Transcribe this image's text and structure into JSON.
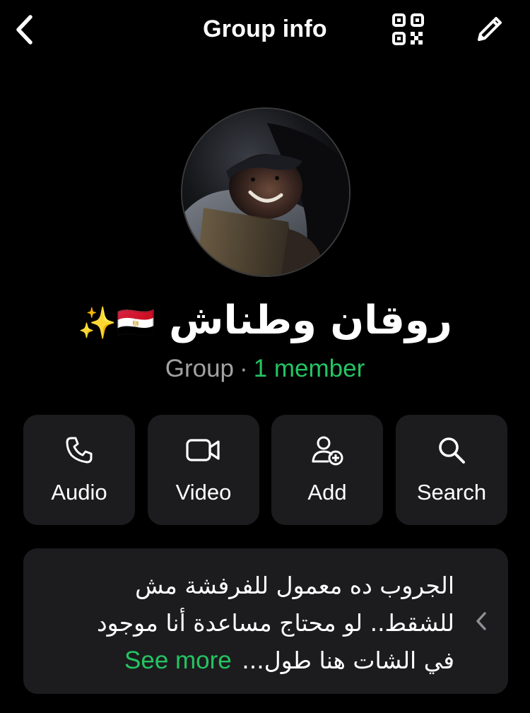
{
  "header": {
    "title": "Group info",
    "back_icon": "chevron-left-icon",
    "qr_icon": "qr-code-icon",
    "edit_icon": "pencil-icon"
  },
  "group": {
    "name": "روقان وطناش",
    "name_emojis": "🇪🇬✨",
    "type": "Group",
    "separator": "·",
    "members": "1 member"
  },
  "actions": [
    {
      "label": "Audio",
      "icon": "phone-icon"
    },
    {
      "label": "Video",
      "icon": "video-camera-icon"
    },
    {
      "label": "Add",
      "icon": "add-person-icon"
    },
    {
      "label": "Search",
      "icon": "search-icon"
    }
  ],
  "about": {
    "lines": [
      "الجروب ده معمول للفرفشة مش",
      "للشقط.. لو محتاج مساعدة أنا موجود",
      "في الشات هنا طول..."
    ],
    "see_more": "See more"
  },
  "colors": {
    "background": "#000000",
    "card": "#1c1c1e",
    "accent_green": "#24c462",
    "secondary_text": "#a2a2a2"
  }
}
